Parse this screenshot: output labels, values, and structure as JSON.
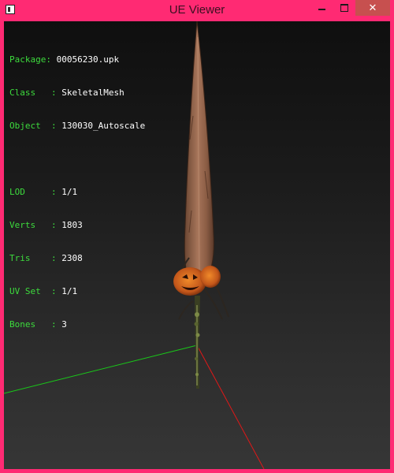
{
  "window": {
    "title": "UE Viewer",
    "controls": {
      "minimize": "minimize-icon",
      "maximize": "maximize-icon",
      "close": "close-icon"
    }
  },
  "info": {
    "package_label": "Package",
    "package_value": "00056230.upk",
    "class_label": "Class",
    "class_value": "SkeletalMesh",
    "object_label": "Object",
    "object_value": "130030_Autoscale",
    "lod_label": "LOD",
    "lod_value": "1/1",
    "verts_label": "Verts",
    "verts_value": "1803",
    "tris_label": "Tris",
    "tris_value": "2308",
    "uvset_label": "UV Set",
    "uvset_value": "1/1",
    "bones_label": "Bones",
    "bones_value": "3"
  },
  "colors": {
    "frame": "#ff2a73",
    "close_button": "#c7504f",
    "label_text": "#3ddb3d",
    "value_text": "#ffffff",
    "axis_x": "#e01818",
    "axis_y": "#19c819"
  }
}
